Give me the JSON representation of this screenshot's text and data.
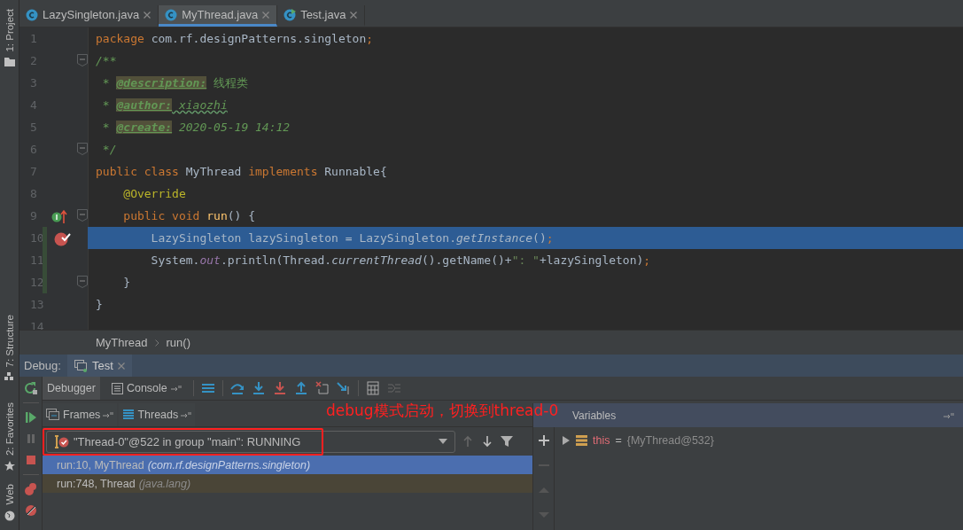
{
  "side_tool_strip": [
    {
      "label": "1: Project",
      "kind": "folder"
    },
    {
      "label": "7: Structure",
      "kind": "structure"
    },
    {
      "label": "2: Favorites",
      "kind": "star"
    },
    {
      "label": "Web",
      "kind": "web"
    }
  ],
  "editor_tabs": [
    {
      "label": "LazySingleton.java",
      "kind": "class",
      "selected": false
    },
    {
      "label": "MyThread.java",
      "kind": "class",
      "selected": true
    },
    {
      "label": "Test.java",
      "kind": "runnable",
      "selected": false
    }
  ],
  "code_lines": [
    {
      "number": "1",
      "tokens": [
        {
          "text": "package ",
          "kind": "keyword"
        },
        {
          "text": "com.rf.designPatterns.singleton",
          "kind": "plain"
        },
        {
          "text": ";",
          "kind": "keyword"
        }
      ]
    },
    {
      "number": "2",
      "fold": true,
      "tokens": [
        {
          "text": "/**",
          "kind": "comment"
        }
      ]
    },
    {
      "number": "3",
      "tokens": [
        {
          "text": " * ",
          "kind": "comment"
        },
        {
          "text": "@description:",
          "kind": "doctag"
        },
        {
          "text": " 线程类",
          "kind": "commentplain"
        }
      ]
    },
    {
      "number": "4",
      "tokens": [
        {
          "text": " * ",
          "kind": "comment"
        },
        {
          "text": "@author:",
          "kind": "doctag"
        },
        {
          "text": " xiaozhi",
          "kind": "typo"
        }
      ]
    },
    {
      "number": "5",
      "tokens": [
        {
          "text": " * ",
          "kind": "comment"
        },
        {
          "text": "@create:",
          "kind": "doctag"
        },
        {
          "text": " 2020-05-19 14:12",
          "kind": "comment"
        }
      ]
    },
    {
      "number": "6",
      "fold": true,
      "tokens": [
        {
          "text": " */",
          "kind": "comment"
        }
      ]
    },
    {
      "number": "7",
      "tokens": [
        {
          "text": "public class ",
          "kind": "keyword"
        },
        {
          "text": "MyThread ",
          "kind": "plain"
        },
        {
          "text": "implements ",
          "kind": "keyword"
        },
        {
          "text": "Runnable{",
          "kind": "plain"
        }
      ]
    },
    {
      "number": "8",
      "tokens": [
        {
          "text": "    @Override",
          "kind": "annotation"
        }
      ]
    },
    {
      "number": "9",
      "fold": true,
      "implements_marker": true,
      "tokens": [
        {
          "text": "    public void ",
          "kind": "keyword"
        },
        {
          "text": "run",
          "kind": "method"
        },
        {
          "text": "() {",
          "kind": "plain"
        }
      ]
    },
    {
      "number": "10",
      "highlighted": true,
      "breakpoint": true,
      "changed": true,
      "tokens": [
        {
          "text": "        LazySingleton lazySingleton = LazySingleton.",
          "kind": "plain"
        },
        {
          "text": "getInstance",
          "kind": "static"
        },
        {
          "text": "()",
          "kind": "plain"
        },
        {
          "text": ";",
          "kind": "keyword"
        }
      ]
    },
    {
      "number": "11",
      "changed": true,
      "tokens": [
        {
          "text": "        System.",
          "kind": "plain"
        },
        {
          "text": "out",
          "kind": "field"
        },
        {
          "text": ".println(Thread.",
          "kind": "plain"
        },
        {
          "text": "currentThread",
          "kind": "static"
        },
        {
          "text": "().getName()+",
          "kind": "plain"
        },
        {
          "text": "\": \"",
          "kind": "string"
        },
        {
          "text": "+lazySingleton)",
          "kind": "plain"
        },
        {
          "text": ";",
          "kind": "keyword"
        }
      ]
    },
    {
      "number": "12",
      "fold": true,
      "changed": true,
      "tokens": [
        {
          "text": "    }",
          "kind": "plain"
        }
      ]
    },
    {
      "number": "13",
      "tokens": [
        {
          "text": "}",
          "kind": "plain"
        }
      ]
    },
    {
      "number": "14"
    }
  ],
  "breadcrumbs": [
    "MyThread",
    "run()"
  ],
  "debug_window": {
    "title": "Debug:",
    "tab": "Test"
  },
  "debugger_tabs": [
    {
      "label": "Debugger",
      "selected": true,
      "pinnable": false
    },
    {
      "label": "Console",
      "selected": false,
      "pinnable": true
    }
  ],
  "pane_tabs": [
    {
      "label": "Frames",
      "kind": "frames"
    },
    {
      "label": "Threads",
      "kind": "threads"
    }
  ],
  "thread_selector": {
    "value": "\"Thread-0\"@522 in group \"main\": RUNNING"
  },
  "frames": [
    {
      "method": "run:10, MyThread",
      "package": "(com.rf.designPatterns.singleton)",
      "kind": "app",
      "selected": true
    },
    {
      "method": "run:748, Thread",
      "package": "(java.lang)",
      "kind": "library",
      "selected": false
    }
  ],
  "variables": {
    "header": "Variables",
    "items": [
      {
        "name": "this",
        "operator": "=",
        "value": "{MyThread@532}",
        "expanded": false
      }
    ]
  },
  "annotation": {
    "text": "debug模式启动，切换到thread-0"
  }
}
